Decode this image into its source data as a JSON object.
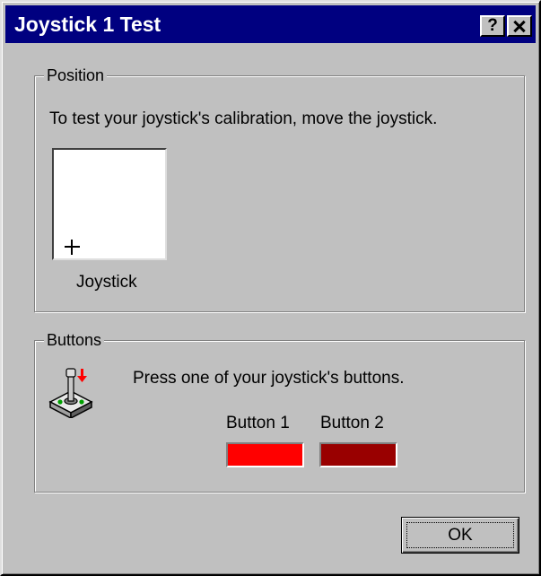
{
  "window": {
    "title": "Joystick 1 Test",
    "help_label": "?"
  },
  "position_group": {
    "legend": "Position",
    "instruction": "To test your joystick's calibration, move the joystick.",
    "area_label": "Joystick"
  },
  "buttons_group": {
    "legend": "Buttons",
    "icon": "joystick-icon",
    "instruction": "Press one of your joystick's buttons.",
    "buttons": [
      {
        "label": "Button 1",
        "color": "#ff0000"
      },
      {
        "label": "Button 2",
        "color": "#990000"
      }
    ]
  },
  "footer": {
    "ok_label": "OK"
  },
  "colors": {
    "title_bar": "#000080",
    "face": "#c0c0c0"
  }
}
